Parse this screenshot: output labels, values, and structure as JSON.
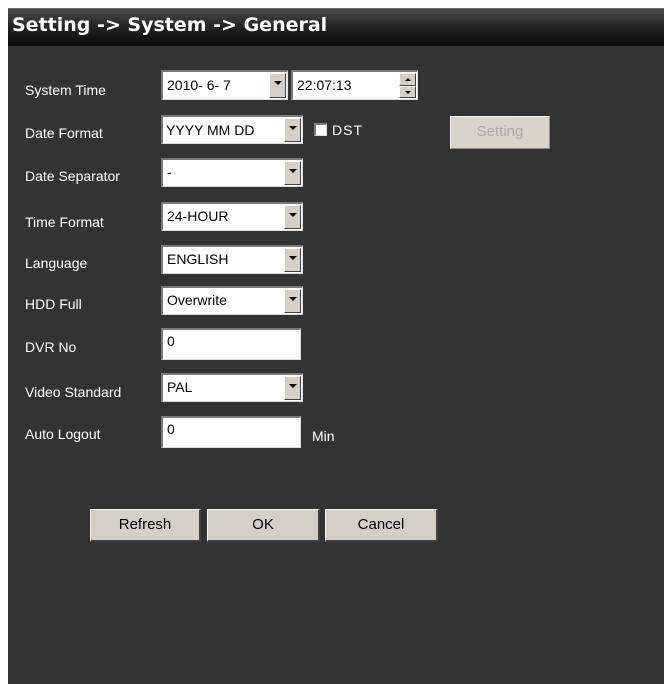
{
  "window": {
    "title": "Setting -> System -> General"
  },
  "form": {
    "system_time": {
      "label": "System Time",
      "date_value": "2010- 6- 7",
      "time_value": "22:07:13"
    },
    "date_format": {
      "label": "Date Format",
      "value": "YYYY MM DD",
      "dst_label": "DST",
      "dst_checked": false,
      "setting_button": "Setting"
    },
    "date_separator": {
      "label": "Date Separator",
      "value": "-"
    },
    "time_format": {
      "label": "Time Format",
      "value": "24-HOUR"
    },
    "language": {
      "label": "Language",
      "value": "ENGLISH"
    },
    "hdd_full": {
      "label": "HDD Full",
      "value": "Overwrite"
    },
    "dvr_no": {
      "label": "DVR No",
      "value": "0"
    },
    "video_standard": {
      "label": "Video Standard",
      "value": "PAL"
    },
    "auto_logout": {
      "label": "Auto Logout",
      "value": "0",
      "unit": "Min"
    }
  },
  "buttons": {
    "refresh": "Refresh",
    "ok": "OK",
    "cancel": "Cancel"
  },
  "colors": {
    "panel_background": "#333333",
    "control_face": "#d4d0c8",
    "text": "#ffffff"
  }
}
